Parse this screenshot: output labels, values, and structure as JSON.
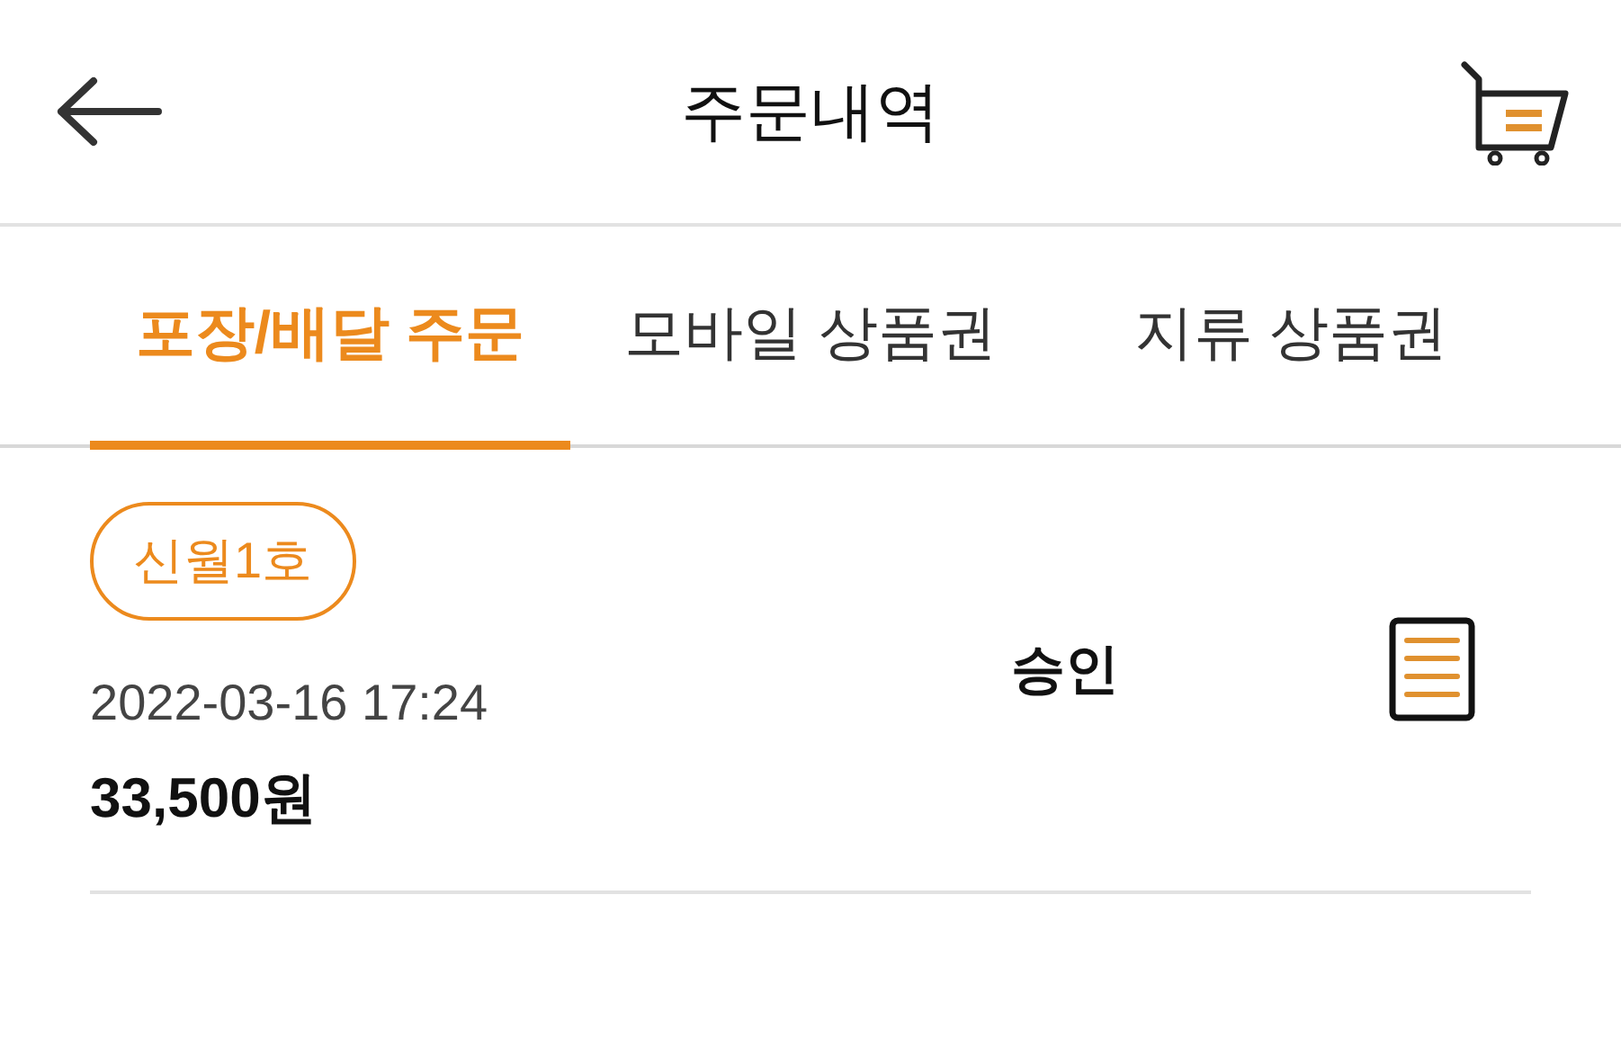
{
  "header": {
    "title": "주문내역"
  },
  "tabs": [
    {
      "label": "포장/배달 주문",
      "selected": true
    },
    {
      "label": "모바일 상품권",
      "selected": false
    },
    {
      "label": "지류 상품권",
      "selected": false
    }
  ],
  "orders": [
    {
      "store": "신월1호",
      "date": "2022-03-16 17:24",
      "amount": "33,500원",
      "status": "승인"
    }
  ]
}
